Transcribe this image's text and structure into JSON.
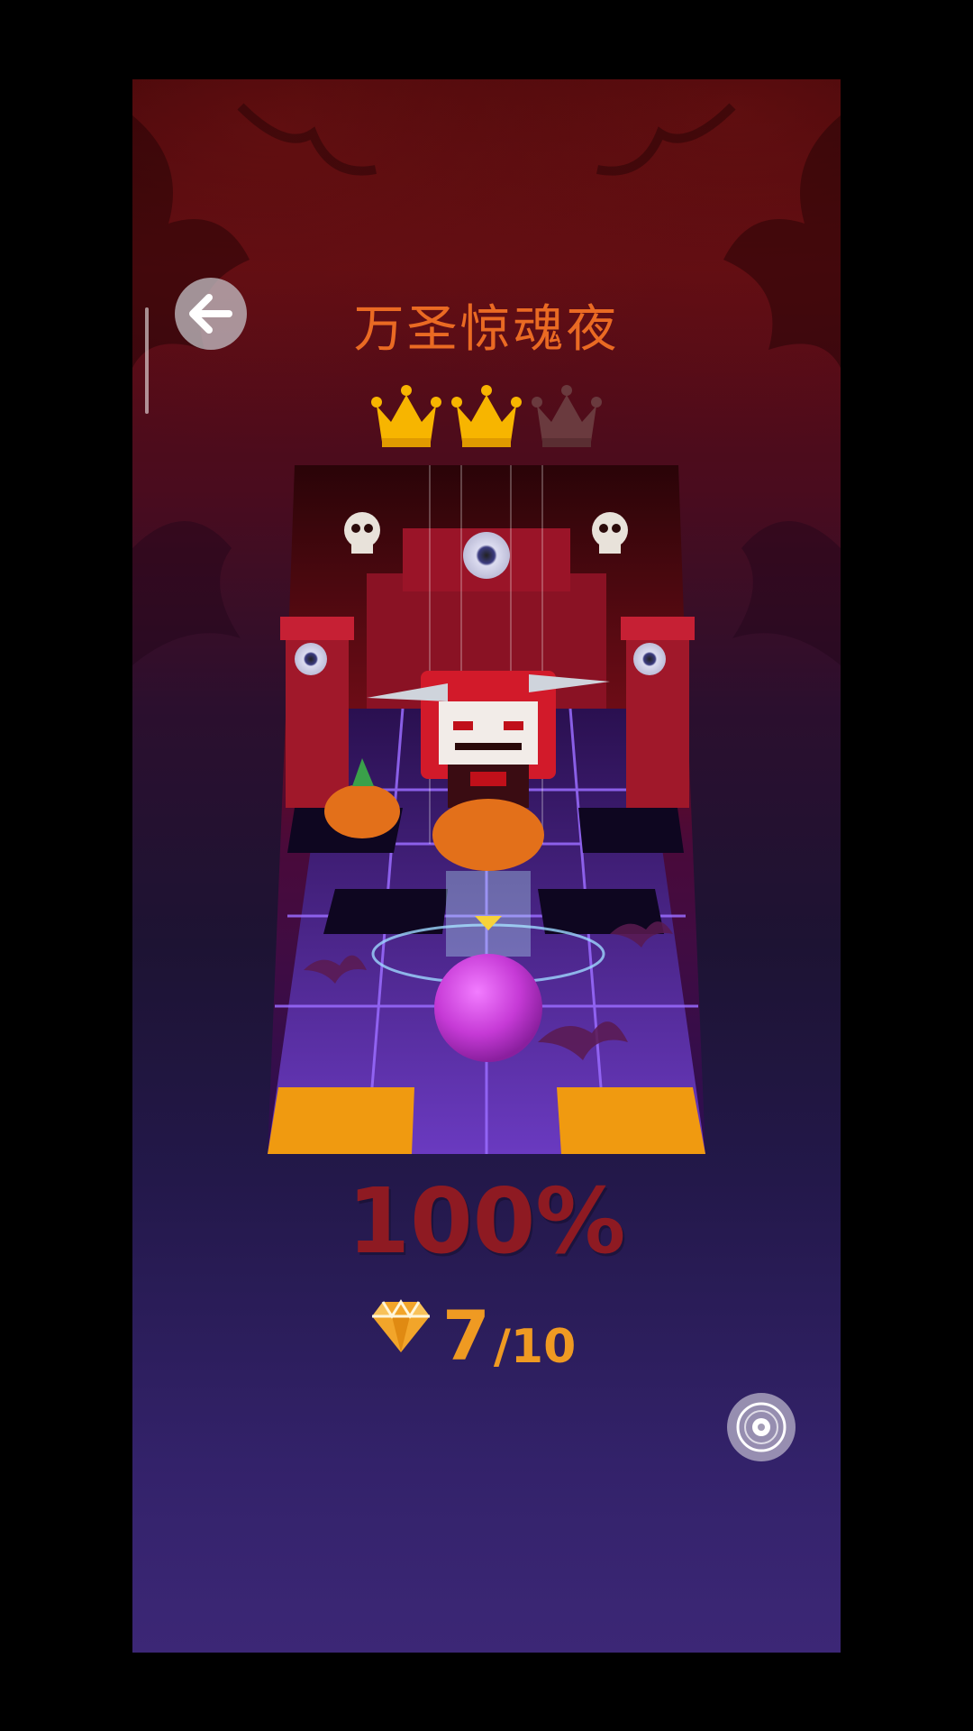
{
  "header": {
    "back_icon": "arrow-left-icon",
    "title": "万圣惊魂夜"
  },
  "rating": {
    "crowns_earned": 2,
    "crowns_total": 3,
    "earned_color": "#f7b500",
    "empty_color": "#6a3a3e"
  },
  "result": {
    "percent": "100%",
    "gems_collected": "7",
    "gems_total": "/10",
    "gem_icon": "diamond-icon"
  },
  "controls": {
    "music_icon": "music-disc-icon"
  },
  "colors": {
    "title": "#ea6a23",
    "percent": "#8e1a22",
    "gems": "#ef9a22",
    "ball": "#c63ad6",
    "tile_highlight": "#f09a10"
  }
}
